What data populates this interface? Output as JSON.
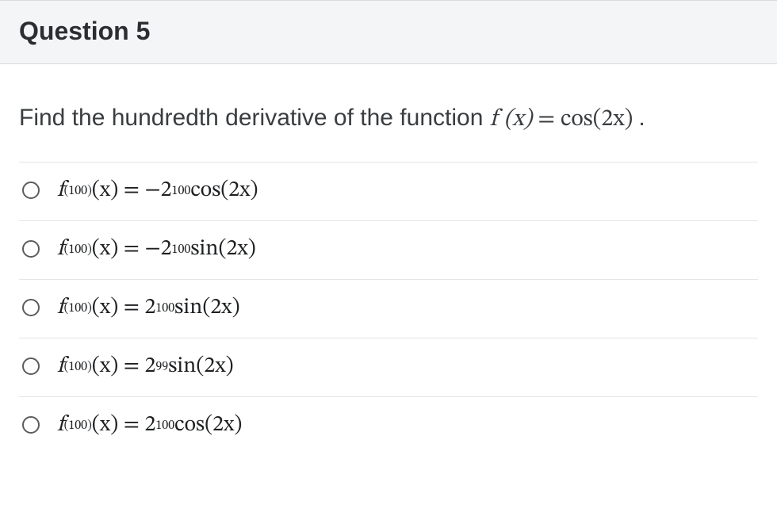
{
  "header": {
    "title": "Question 5"
  },
  "prompt": {
    "lead": "Find the hundredth derivative of the function ",
    "func_lhs": "f (x)",
    "equals": " = ",
    "func_rhs": "cos(2x)",
    "period": " ."
  },
  "options": [
    {
      "sup1": "(100)",
      "mid": " (x) = −2",
      "sup2": "100",
      "trig": " cos(2x)"
    },
    {
      "sup1": "(100)",
      "mid": " (x) = −2",
      "sup2": "100",
      "trig": " sin(2x)"
    },
    {
      "sup1": "(100)",
      "mid": " (x) = 2",
      "sup2": "100",
      "trig": " sin(2x)"
    },
    {
      "sup1": "(100)",
      "mid": " (x) = 2",
      "sup2": "99",
      "trig": " sin(2x)"
    },
    {
      "sup1": "(100)",
      "mid": " (x) = 2",
      "sup2": "100",
      "trig": " cos(2x)"
    }
  ]
}
